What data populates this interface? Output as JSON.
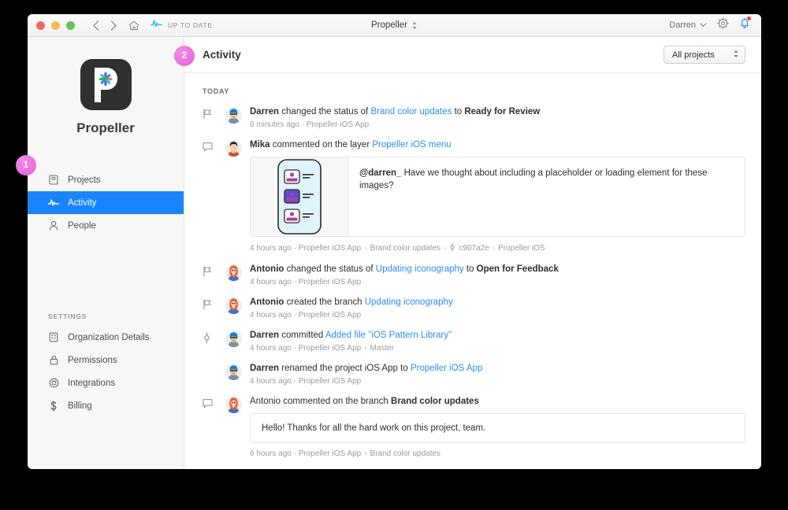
{
  "titlebar": {
    "status_text": "UP TO DATE",
    "title": "Propeller",
    "user": "Darren",
    "icons": {
      "back": "chevron-left-icon",
      "forward": "chevron-right-icon",
      "home": "home-icon",
      "sync": "propeller-mark-icon",
      "gear": "gear-icon",
      "bell": "bell-icon"
    }
  },
  "sidebar": {
    "brand_name": "Propeller",
    "nav": [
      {
        "label": "Projects",
        "icon": "projects-icon",
        "active": false
      },
      {
        "label": "Activity",
        "icon": "activity-icon",
        "active": true
      },
      {
        "label": "People",
        "icon": "people-icon",
        "active": false
      }
    ],
    "settings_header": "SETTINGS",
    "settings": [
      {
        "label": "Organization Details",
        "icon": "building-icon"
      },
      {
        "label": "Permissions",
        "icon": "lock-icon"
      },
      {
        "label": "Integrations",
        "icon": "plug-icon"
      },
      {
        "label": "Billing",
        "icon": "dollar-icon"
      }
    ]
  },
  "main": {
    "page_title": "Activity",
    "project_filter": "All projects",
    "day_label": "TODAY"
  },
  "activity": [
    {
      "icon": "branch-flag-icon",
      "avatar": "darren",
      "text_parts": [
        {
          "t": "Darren",
          "s": "bold"
        },
        {
          "t": " changed the status of ",
          "s": "plain"
        },
        {
          "t": "Brand color updates",
          "s": "link"
        },
        {
          "t": " to ",
          "s": "plain"
        },
        {
          "t": "Ready for Review",
          "s": "bold"
        }
      ],
      "meta": [
        "6 minutes ago · Propeller iOS App"
      ]
    },
    {
      "icon": "comment-icon",
      "avatar": "mika",
      "text_parts": [
        {
          "t": "Mika",
          "s": "bold"
        },
        {
          "t": " commented on the layer ",
          "s": "plain"
        },
        {
          "t": "Propeller iOS menu",
          "s": "link"
        }
      ],
      "card": {
        "has_thumb": true,
        "thumb_name": "ios-menu-screen-thumbnail",
        "comment_mention": "@darren_",
        "comment_body": " Have we thought about including a placeholder or loading element for these images?"
      },
      "meta": [
        "4 hours ago · Propeller iOS App",
        "Brand color updates",
        "c907a2e",
        "Propeller iOS"
      ],
      "meta_has_commit_icon": true
    },
    {
      "icon": "branch-flag-icon",
      "avatar": "antonio",
      "text_parts": [
        {
          "t": "Antonio",
          "s": "bold"
        },
        {
          "t": " changed the status of ",
          "s": "plain"
        },
        {
          "t": "Updating iconography",
          "s": "link"
        },
        {
          "t": " to ",
          "s": "plain"
        },
        {
          "t": "Open for Feedback",
          "s": "bold"
        }
      ],
      "meta": [
        "4 hours ago · Propeller iOS App"
      ]
    },
    {
      "icon": "branch-flag-icon",
      "avatar": "antonio",
      "text_parts": [
        {
          "t": "Antonio",
          "s": "bold"
        },
        {
          "t": " created the branch ",
          "s": "plain"
        },
        {
          "t": "Updating iconography",
          "s": "link"
        }
      ],
      "meta": [
        "4 hours ago · Propeller iOS App"
      ]
    },
    {
      "icon": "commit-icon",
      "avatar": "darren",
      "text_parts": [
        {
          "t": "Darren",
          "s": "bold"
        },
        {
          "t": " committed ",
          "s": "plain"
        },
        {
          "t": "Added file \"iOS Pattern Library\"",
          "s": "link"
        }
      ],
      "meta": [
        "4 hours ago · Propeller iOS App",
        "Master"
      ]
    },
    {
      "icon": "",
      "avatar": "darren",
      "text_parts": [
        {
          "t": "Darren",
          "s": "bold"
        },
        {
          "t": " renamed the project iOS App to ",
          "s": "plain"
        },
        {
          "t": "Propeller iOS App",
          "s": "link"
        }
      ],
      "meta": [
        "4 hours ago · Propeller iOS App"
      ]
    },
    {
      "icon": "comment-icon",
      "avatar": "antonio",
      "text_parts": [
        {
          "t": "Antonio",
          "s": "plain"
        },
        {
          "t": " commented on the branch ",
          "s": "plain"
        },
        {
          "t": "Brand color updates",
          "s": "bold"
        }
      ],
      "card": {
        "has_thumb": false,
        "comment_body": "Hello! Thanks for all the hard work on this project, team."
      },
      "meta": [
        "6 hours ago · Propeller iOS App",
        "Brand color updates"
      ]
    }
  ],
  "callouts": [
    {
      "id": "1",
      "label": "1"
    },
    {
      "id": "2",
      "label": "2"
    }
  ],
  "colors": {
    "accent_blue": "#1a85fb",
    "link_blue": "#2f8cf0",
    "callout_pink": "#e564d8",
    "logo_bg": "#2f3032",
    "notification_red": "#f24236"
  }
}
